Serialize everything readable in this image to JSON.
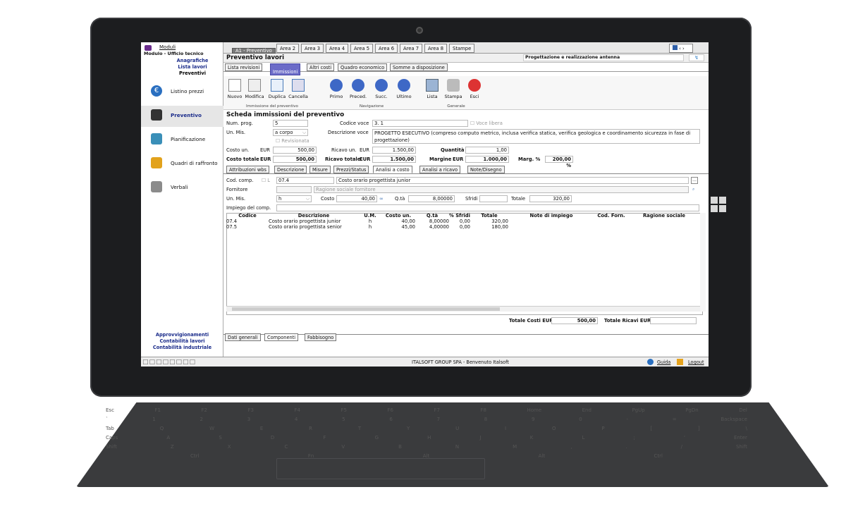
{
  "sidebar": {
    "header": "Moduli",
    "subheader": "Modulo - Ufficio tecnico",
    "links": [
      "Anagrafiche",
      "Lista lavori",
      "Preventivi"
    ],
    "items": [
      {
        "label": "Listino prezzi",
        "icon": "euro-icon"
      },
      {
        "label": "Preventivo",
        "icon": "document-icon"
      },
      {
        "label": "Pianificazione",
        "icon": "chart-icon"
      },
      {
        "label": "Quadri di raffronto",
        "icon": "folder-icon"
      },
      {
        "label": "Verbali",
        "icon": "pen-icon"
      }
    ],
    "footer_links": [
      "Approvvigionamenti",
      "Contabilità lavori",
      "Contabilità industriale"
    ]
  },
  "areatabs": [
    "A1 - Preventivo",
    "Area 2",
    "Area 3",
    "Area 4",
    "Area 5",
    "Area 6",
    "Area 7",
    "Area 8",
    "Stampe"
  ],
  "header": {
    "title": "Preventivo lavori",
    "project": "Progettazione e realizzazione antenna"
  },
  "subtabs": [
    "Lista revisioni",
    "Immissioni",
    "Altri costi",
    "Quadro economico",
    "Somme a disposizione"
  ],
  "toolbar": {
    "groups": [
      "Immissione del preventivo",
      "Navigazione",
      "Generale"
    ],
    "buttons": [
      "Nuovo",
      "Modifica",
      "Duplica",
      "Cancella",
      "Primo",
      "Preced.",
      "Succ.",
      "Ultimo",
      "Lista",
      "Stampa",
      "Esci"
    ]
  },
  "scheda": {
    "title": "Scheda immissioni del preventivo",
    "num_prog_label": "Num. prog.",
    "num_prog": "5",
    "codice_voce_label": "Codice voce",
    "codice_voce": "3.   1",
    "voce_libera": "Voce libera",
    "un_mis_label": "Un. Mis.",
    "un_mis": "a corpo",
    "revisionata": "Revisionata",
    "descr_label": "Descrizione voce",
    "descr": "PROGETTO ESECUTIVO (compreso computo metrico, inclusa verifica statica, verifica geologica e coordinamento sicurezza in fase di progettazione)",
    "costo_un_label": "Costo un.",
    "eur": "EUR",
    "costo_un": "500,00",
    "ricavo_un_label": "Ricavo un.",
    "ricavo_un": "1.500,00",
    "quantita_label": "Quantità",
    "quantita": "1,00",
    "costo_tot_label": "Costo totale",
    "costo_tot": "500,00",
    "ricavo_tot_label": "Ricavo totale",
    "ricavo_tot": "1.500,00",
    "margine_label": "Margine",
    "margine": "1.000,00",
    "marg_perc_label": "Marg. %",
    "marg_perc": "200,00 %"
  },
  "innertabs": [
    "Attribuzioni wbs",
    "Descrizione",
    "Misure",
    "Prezzi/Status",
    "Analisi a costo",
    "Analisi a ricavo",
    "Note/Disegno"
  ],
  "analisi": {
    "cod_comp_label": "Cod. comp.",
    "cod_comp": "07.4",
    "cod_comp_desc": "Costo orario progettista junior",
    "fornitore_label": "Fornitore",
    "fornitore_placeholder": "Ragione sociale fornitore",
    "un_mis_label": "Un. Mis.",
    "un_mis": "h",
    "costo_label": "Costo",
    "costo": "40,00",
    "qta_label": "Q.tà",
    "qta": "8,00000",
    "sfridi_label": "Sfridi",
    "totale_label": "Totale",
    "totale": "320,00",
    "impiego_label": "Impiego del comp."
  },
  "grid": {
    "columns": [
      "Codice",
      "Descrizione",
      "U.M.",
      "Costo un.",
      "Q.tà",
      "% Sfridi",
      "Totale",
      "Note di impiego",
      "Cod. Forn.",
      "Ragione sociale"
    ],
    "rows": [
      [
        "07.4",
        "Costo orario progettista junior",
        "h",
        "40,00",
        "8,00000",
        "0,00",
        "320,00",
        "",
        "",
        ""
      ],
      [
        "07.5",
        "Costo orario progettista senior",
        "h",
        "45,00",
        "4,00000",
        "0,00",
        "180,00",
        "",
        "",
        ""
      ]
    ]
  },
  "totals": {
    "costi_label": "Totale Costi EUR",
    "costi": "500,00",
    "ricavi_label": "Totale Ricavi EUR",
    "ricavi": ""
  },
  "bottomtabs": [
    "Dati generali",
    "Componenti",
    "Fabbisogno"
  ],
  "status": {
    "company": "ITALSOFT GROUP SPA - Benvenuto Italsoft",
    "guida": "Guida",
    "logout": "Logout"
  },
  "keyboard": {
    "row1": [
      "Esc",
      "F1",
      "F2",
      "F3",
      "F4",
      "F5",
      "F6",
      "F7",
      "F8",
      "Home",
      "End",
      "PgUp",
      "PgDn",
      "Del"
    ],
    "row2": [
      "`",
      "1",
      "2",
      "3",
      "4",
      "5",
      "6",
      "7",
      "8",
      "9",
      "0",
      "-",
      "=",
      "Backspace"
    ],
    "row3": [
      "Tab",
      "Q",
      "W",
      "E",
      "R",
      "T",
      "Y",
      "U",
      "I",
      "O",
      "P",
      "[",
      "]",
      "\\"
    ],
    "row4": [
      "Caps",
      "A",
      "S",
      "D",
      "F",
      "G",
      "H",
      "J",
      "K",
      "L",
      ";",
      "'",
      "Enter"
    ],
    "row5": [
      "Shift",
      "Z",
      "X",
      "C",
      "V",
      "B",
      "N",
      "M",
      ",",
      ".",
      "/",
      "Shift"
    ],
    "row6": [
      "Ctrl",
      "Fn",
      "Alt",
      "Alt",
      "Ctrl"
    ]
  }
}
